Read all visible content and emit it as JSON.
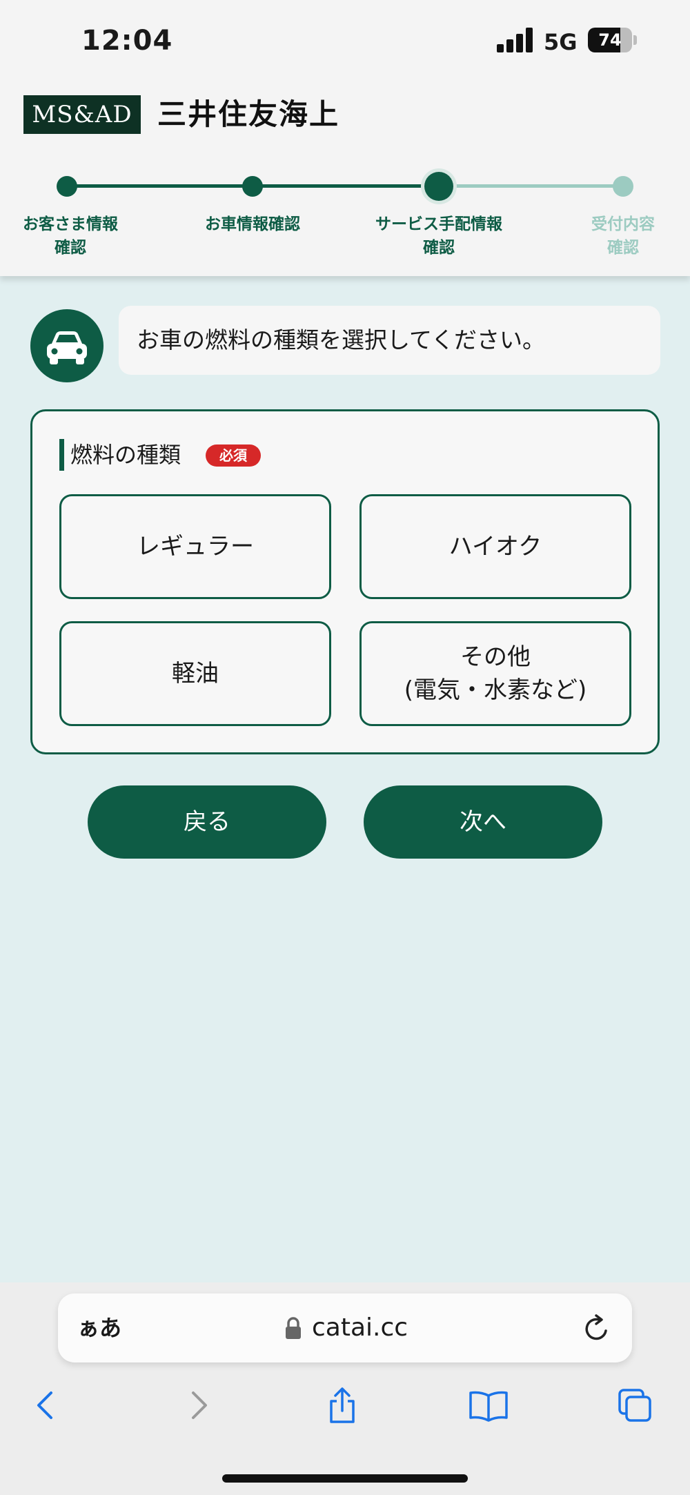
{
  "status_bar": {
    "time": "12:04",
    "network": "5G",
    "battery": "74",
    "battery_level": 0.74
  },
  "header": {
    "logo_text": "MS&AD",
    "company_name": "三井住友海上"
  },
  "stepper": {
    "steps": [
      {
        "label_line1": "お客さま情報",
        "label_line2": "確認",
        "state": "done"
      },
      {
        "label_line1": "お車情報確認",
        "label_line2": "",
        "state": "done"
      },
      {
        "label_line1": "サービス手配情報",
        "label_line2": "確認",
        "state": "current"
      },
      {
        "label_line1": "受付内容",
        "label_line2": "確認",
        "state": "todo"
      }
    ]
  },
  "question": {
    "icon": "car-icon",
    "text": "お車の燃料の種類を選択してください。"
  },
  "fuel_section": {
    "title": "燃料の種類",
    "required_label": "必須",
    "options": [
      {
        "line1": "レギュラー",
        "line2": ""
      },
      {
        "line1": "ハイオク",
        "line2": ""
      },
      {
        "line1": "軽油",
        "line2": ""
      },
      {
        "line1": "その他",
        "line2": "(電気・水素など)"
      }
    ]
  },
  "buttons": {
    "back": "戻る",
    "next": "次へ"
  },
  "browser": {
    "aa_label": "ぁあ",
    "url": "catai.cc"
  },
  "colors": {
    "primary": "#0e5c45",
    "background": "#e1eff0",
    "required": "#d62828",
    "inactive_step": "#9ccbc1",
    "link_blue": "#1a73e8"
  }
}
